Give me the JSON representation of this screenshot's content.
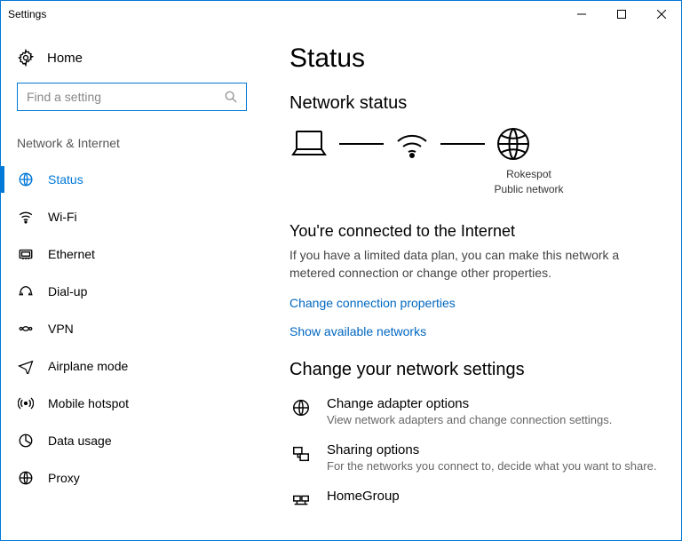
{
  "window": {
    "title": "Settings"
  },
  "sidebar": {
    "home": "Home",
    "search_placeholder": "Find a setting",
    "category": "Network & Internet",
    "items": [
      {
        "label": "Status",
        "icon": "status"
      },
      {
        "label": "Wi-Fi",
        "icon": "wifi"
      },
      {
        "label": "Ethernet",
        "icon": "ethernet"
      },
      {
        "label": "Dial-up",
        "icon": "dialup"
      },
      {
        "label": "VPN",
        "icon": "vpn"
      },
      {
        "label": "Airplane mode",
        "icon": "airplane"
      },
      {
        "label": "Mobile hotspot",
        "icon": "hotspot"
      },
      {
        "label": "Data usage",
        "icon": "datausage"
      },
      {
        "label": "Proxy",
        "icon": "proxy"
      }
    ]
  },
  "main": {
    "page_title": "Status",
    "section1_title": "Network status",
    "diagram": {
      "network_name": "Rokespot",
      "network_type": "Public network"
    },
    "connected_title": "You're connected to the Internet",
    "connected_desc": "If you have a limited data plan, you can make this network a metered connection or change other properties.",
    "link_change_props": "Change connection properties",
    "link_show_networks": "Show available networks",
    "section2_title": "Change your network settings",
    "settings": [
      {
        "title": "Change adapter options",
        "desc": "View network adapters and change connection settings."
      },
      {
        "title": "Sharing options",
        "desc": "For the networks you connect to, decide what you want to share."
      },
      {
        "title": "HomeGroup",
        "desc": ""
      }
    ]
  }
}
